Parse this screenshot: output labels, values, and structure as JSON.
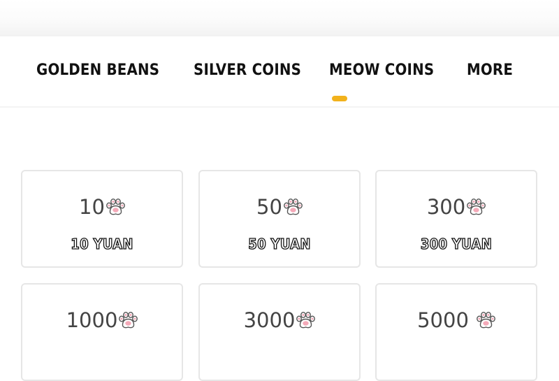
{
  "tabs": [
    {
      "label": "GOLDEN BEANS"
    },
    {
      "label": "SILVER COINS"
    },
    {
      "label": "MEOW COINS",
      "active": true
    },
    {
      "label": "MORE"
    }
  ],
  "accent_color": "#f2b21c",
  "currency_icon": "cat-paw-icon",
  "packages": [
    {
      "amount": "10",
      "price": "10 YUAN"
    },
    {
      "amount": "50",
      "price": "50 YUAN"
    },
    {
      "amount": "300",
      "price": "300 YUAN"
    },
    {
      "amount": "1000",
      "price": ""
    },
    {
      "amount": "3000",
      "price": ""
    },
    {
      "amount": "5000",
      "price": ""
    }
  ]
}
